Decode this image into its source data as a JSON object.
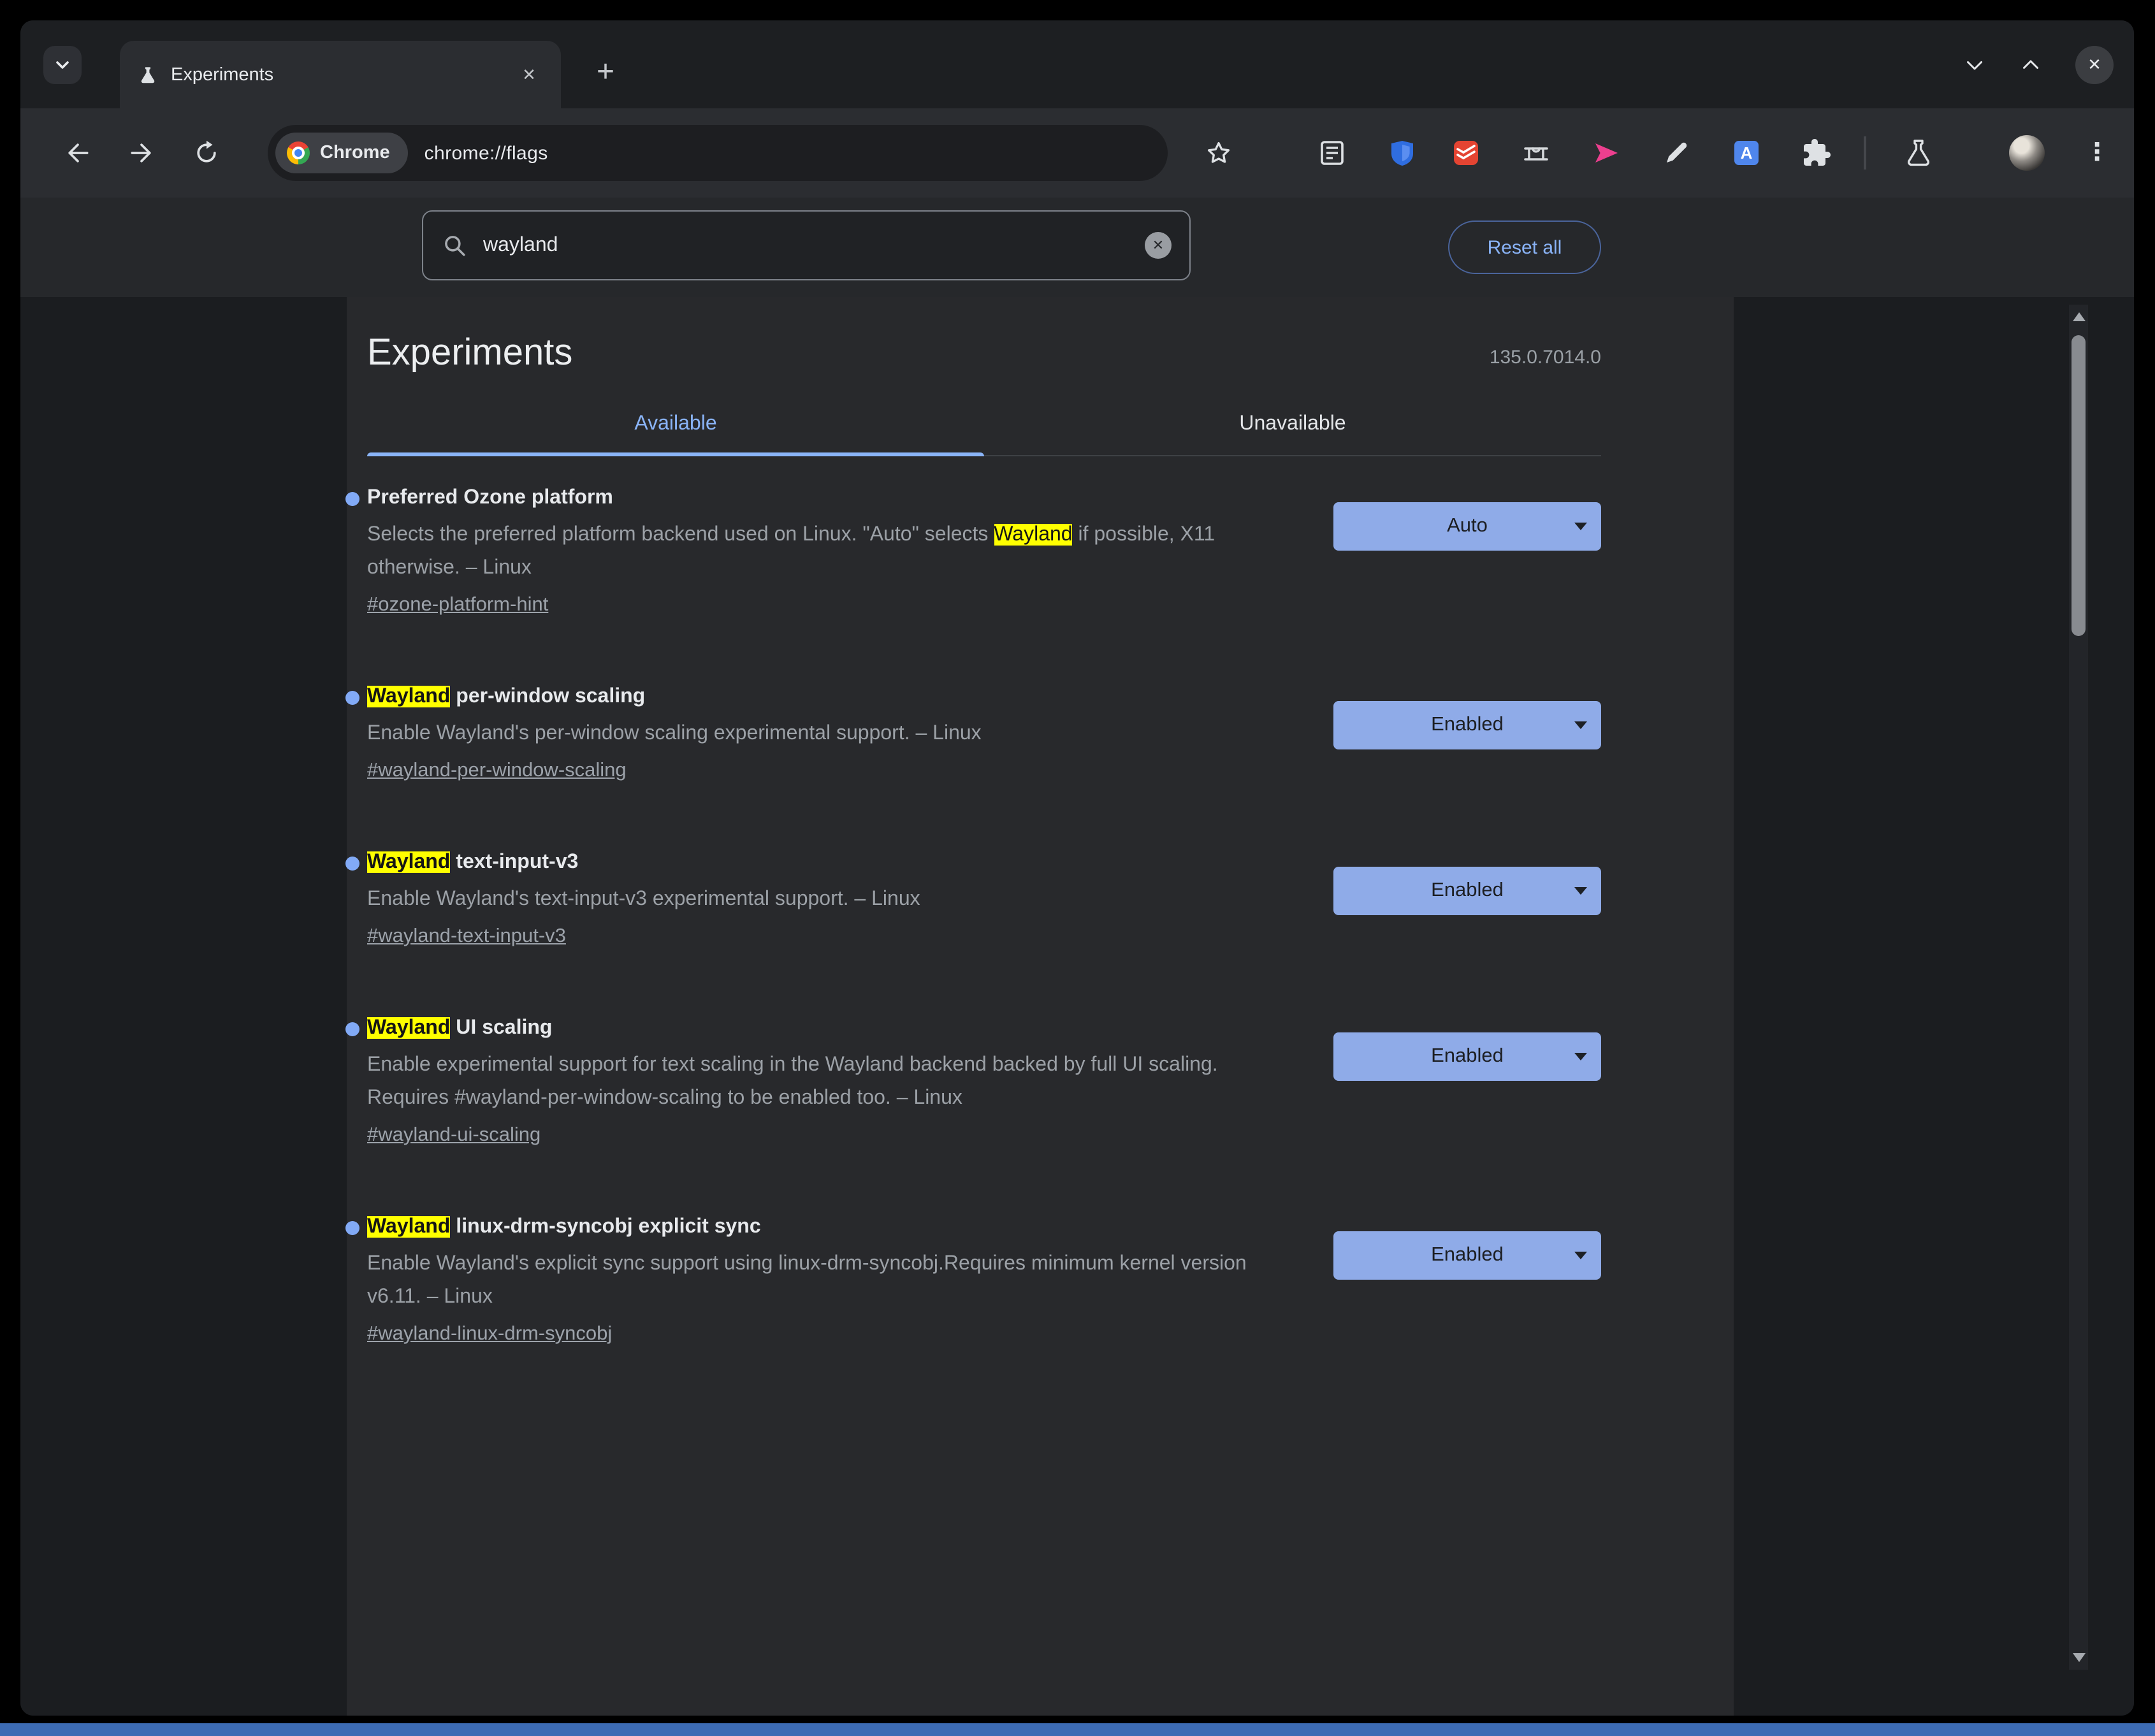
{
  "colors": {
    "accent_blue": "#8ab4f8",
    "highlight_yellow": "#ffff00",
    "select_bg": "#8fabe8",
    "bitwarden_blue": "#2f6de0",
    "todoist_red": "#e44432",
    "translate_blue": "#4f86ec",
    "pink_extension": "#ed3f8f",
    "taskbar_blue": "#3d6cb4"
  },
  "window": {
    "tab_title": "Experiments"
  },
  "toolbar": {
    "site_chip": "Chrome",
    "url": "chrome://flags"
  },
  "search": {
    "value": "wayland",
    "reset_label": "Reset all"
  },
  "page": {
    "title": "Experiments",
    "version": "135.0.7014.0",
    "tabs": {
      "available": "Available",
      "unavailable": "Unavailable"
    },
    "flags": [
      {
        "title_highlight": "",
        "title_rest": "Preferred Ozone platform",
        "desc_pre": "Selects the preferred platform backend used on Linux. \"Auto\" selects ",
        "desc_highlight": "Wayland",
        "desc_post": " if possible, X11 otherwise. – Linux",
        "link": "#ozone-platform-hint",
        "value": "Auto"
      },
      {
        "title_highlight": "Wayland",
        "title_rest": " per-window scaling",
        "desc_pre": "Enable Wayland's per-window scaling experimental support. – Linux",
        "desc_highlight": "",
        "desc_post": "",
        "link": "#wayland-per-window-scaling",
        "value": "Enabled"
      },
      {
        "title_highlight": "Wayland",
        "title_rest": " text-input-v3",
        "desc_pre": "Enable Wayland's text-input-v3 experimental support. – Linux",
        "desc_highlight": "",
        "desc_post": "",
        "link": "#wayland-text-input-v3",
        "value": "Enabled"
      },
      {
        "title_highlight": "Wayland",
        "title_rest": " UI scaling",
        "desc_pre": "Enable experimental support for text scaling in the Wayland backend backed by full UI scaling. Requires #wayland-per-window-scaling to be enabled too. – Linux",
        "desc_highlight": "",
        "desc_post": "",
        "link": "#wayland-ui-scaling",
        "value": "Enabled"
      },
      {
        "title_highlight": "Wayland",
        "title_rest": " linux-drm-syncobj explicit sync",
        "desc_pre": "Enable Wayland's explicit sync support using linux-drm-syncobj.Requires minimum kernel version v6.11. – Linux",
        "desc_highlight": "",
        "desc_post": "",
        "link": "#wayland-linux-drm-syncobj",
        "value": "Enabled"
      }
    ]
  },
  "icons": {
    "plus": "+",
    "close_x": "✕",
    "kebab": "⋮"
  }
}
